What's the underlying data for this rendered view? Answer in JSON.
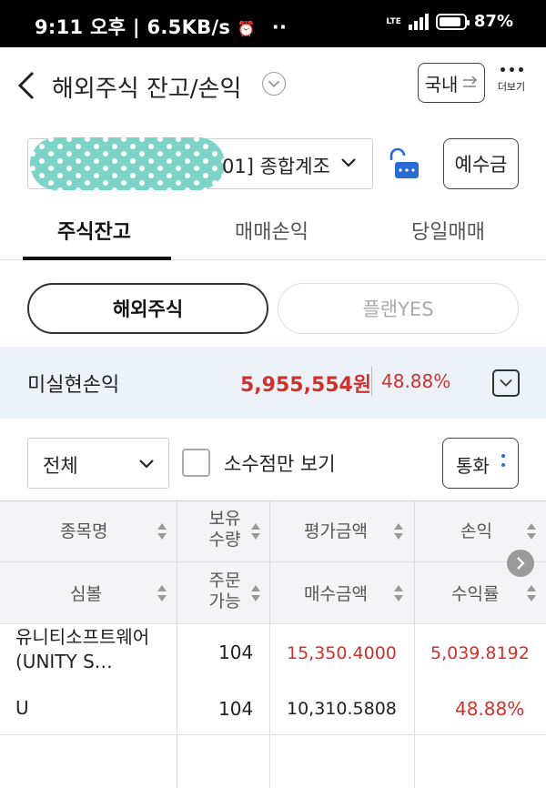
{
  "status_bar": {
    "time": "9:11 오후 | 6.5KB/s",
    "alarm_icon": "alarm-clock-icon",
    "extra": "··",
    "network": "LTE",
    "battery": "87%",
    "battery_level": 0.87
  },
  "header": {
    "title": "해외주식 잔고/손익",
    "domestic_button": "국내",
    "more_label": "더보기"
  },
  "account": {
    "account_text": "01] 종합계조",
    "deposit_button": "예수금"
  },
  "tabs": [
    {
      "label": "주식잔고",
      "active": true
    },
    {
      "label": "매매손익",
      "active": false
    },
    {
      "label": "당일매매",
      "active": false
    }
  ],
  "segments": {
    "foreign": "해외주식",
    "plan": "플랜YES"
  },
  "pnl": {
    "label": "미실현손익",
    "amount": "5,955,554원",
    "rate": "48.88%"
  },
  "filters": {
    "category": "전체",
    "fraction_only": "소수점만 보기",
    "currency_button": "통화"
  },
  "table": {
    "headers_row1": [
      "종목명",
      "보유\n수량",
      "평가금액",
      "손익"
    ],
    "headers_row2": [
      "심볼",
      "주문\n가능",
      "매수금액",
      "수익률"
    ],
    "rows": [
      {
        "name": "유니티소프트웨어(UNITY S…",
        "symbol": "U",
        "qty": "104",
        "orderable": "104",
        "eval_amount": "15,350.4000",
        "buy_amount": "10,310.5808",
        "pnl": "5,039.8192",
        "rate": "48.88%"
      }
    ]
  },
  "colors": {
    "profit": "#d0312d",
    "band": "#edf2f9",
    "lock_icon": "#2a6bd4",
    "mask": "#7dd3c8"
  }
}
